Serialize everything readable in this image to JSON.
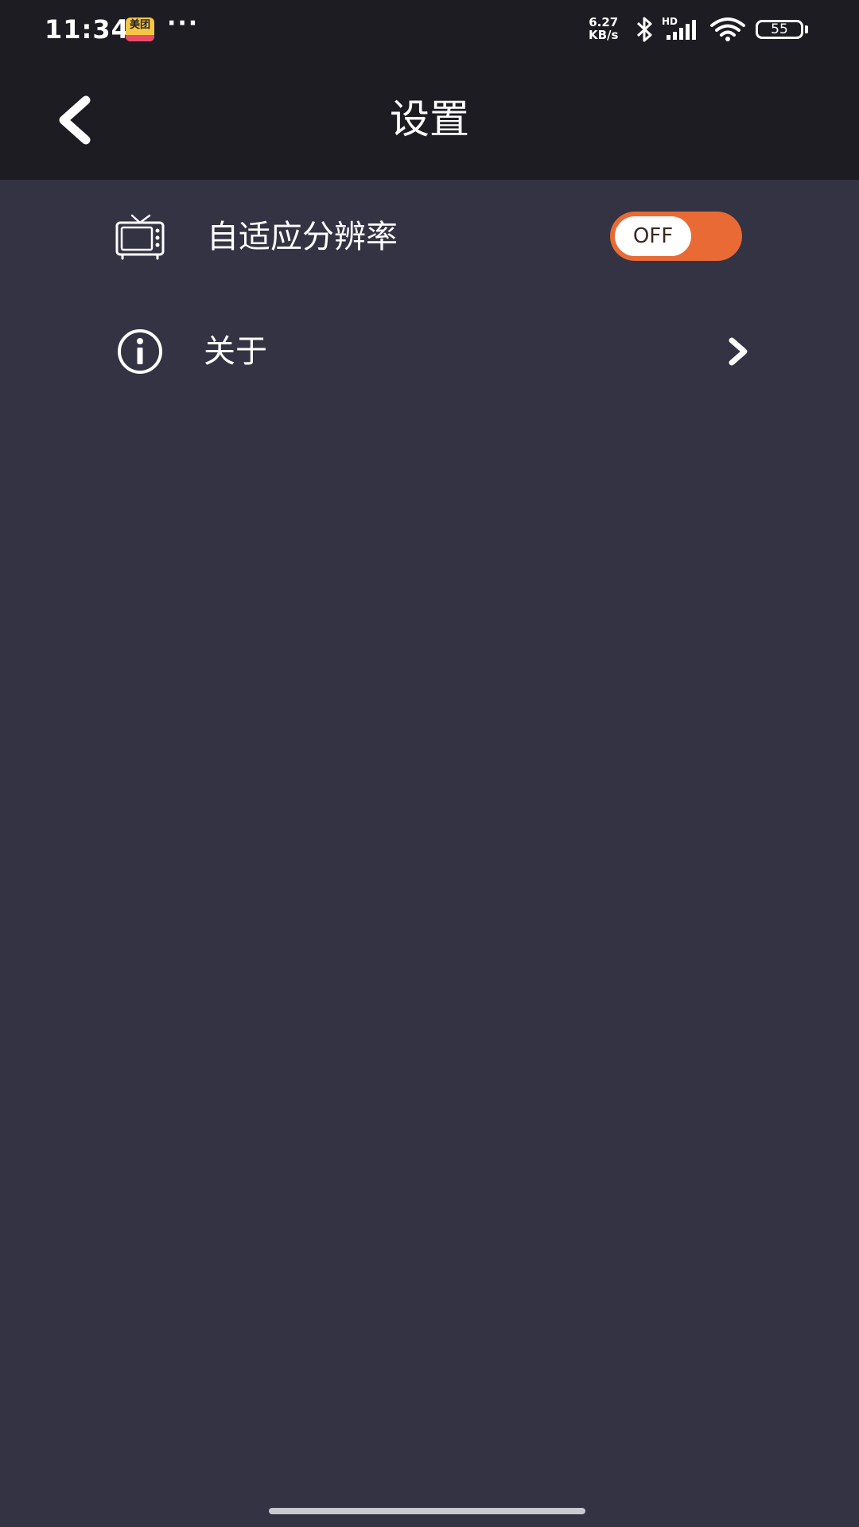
{
  "status_bar": {
    "time": "11:34",
    "app_badge_text": "美团",
    "more_indicator": "···",
    "net_speed_value": "6.27",
    "net_speed_unit": "KB/s",
    "network_type": "HD",
    "battery_level": "55",
    "icons": [
      "meituan-app-icon",
      "bluetooth-icon",
      "signal-icon",
      "wifi-icon",
      "battery-icon"
    ]
  },
  "header": {
    "title": "设置",
    "back_icon": "back-arrow-icon"
  },
  "settings": {
    "items": [
      {
        "label": "自适应分辨率",
        "icon": "tv-icon",
        "control": "toggle",
        "toggle_state": "OFF"
      },
      {
        "label": "关于",
        "icon": "info-icon",
        "control": "chevron-right-icon"
      }
    ]
  },
  "colors": {
    "status_bar_bg": "#1c1c22",
    "header_bg": "#1c1c22",
    "page_bg": "#333344",
    "toggle_accent": "#e96a34",
    "text": "#ffffff"
  }
}
